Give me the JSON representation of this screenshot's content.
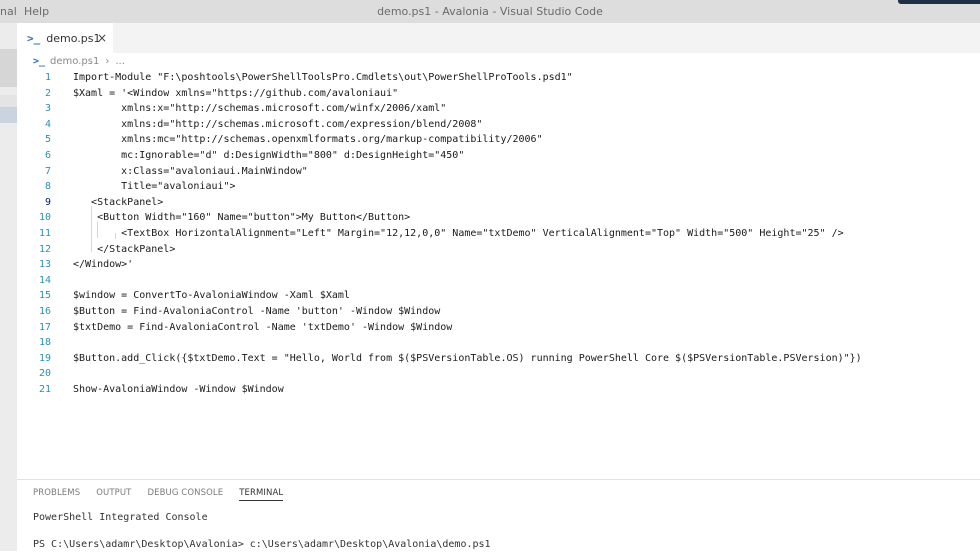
{
  "window": {
    "menu_left": "nal",
    "menu_help": "Help",
    "title": "demo.ps1 - Avalonia - Visual Studio Code"
  },
  "tab": {
    "label": "demo.ps1",
    "icon": "powershell-icon",
    "close": "×"
  },
  "breadcrumb": {
    "file": "demo.ps1",
    "sep": "›",
    "more": "..."
  },
  "editor": {
    "lines": [
      {
        "n": "1",
        "text": "Import-Module \"F:\\poshtools\\PowerShellToolsPro.Cmdlets\\out\\PowerShellProTools.psd1\""
      },
      {
        "n": "2",
        "text": "$Xaml = '<Window xmlns=\"https://github.com/avaloniaui\""
      },
      {
        "n": "3",
        "text": "        xmlns:x=\"http://schemas.microsoft.com/winfx/2006/xaml\""
      },
      {
        "n": "4",
        "text": "        xmlns:d=\"http://schemas.microsoft.com/expression/blend/2008\""
      },
      {
        "n": "5",
        "text": "        xmlns:mc=\"http://schemas.openxmlformats.org/markup-compatibility/2006\""
      },
      {
        "n": "6",
        "text": "        mc:Ignorable=\"d\" d:DesignWidth=\"800\" d:DesignHeight=\"450\""
      },
      {
        "n": "7",
        "text": "        x:Class=\"avaloniaui.MainWindow\""
      },
      {
        "n": "8",
        "text": "        Title=\"avaloniaui\">"
      },
      {
        "n": "9",
        "text": "   <StackPanel>"
      },
      {
        "n": "10",
        "text": "    <Button Width=\"160\" Name=\"button\">My Button</Button>"
      },
      {
        "n": "11",
        "text": "        <TextBox HorizontalAlignment=\"Left\" Margin=\"12,12,0,0\" Name=\"txtDemo\" VerticalAlignment=\"Top\" Width=\"500\" Height=\"25\" />"
      },
      {
        "n": "12",
        "text": "    </StackPanel>"
      },
      {
        "n": "13",
        "text": "</Window>'"
      },
      {
        "n": "14",
        "text": ""
      },
      {
        "n": "15",
        "text": "$window = ConvertTo-AvaloniaWindow -Xaml $Xaml"
      },
      {
        "n": "16",
        "text": "$Button = Find-AvaloniaControl -Name 'button' -Window $Window"
      },
      {
        "n": "17",
        "text": "$txtDemo = Find-AvaloniaControl -Name 'txtDemo' -Window $Window"
      },
      {
        "n": "18",
        "text": ""
      },
      {
        "n": "19",
        "text": "$Button.add_Click({$txtDemo.Text = \"Hello, World from $($PSVersionTable.OS) running PowerShell Core $($PSVersionTable.PSVersion)\"})"
      },
      {
        "n": "20",
        "text": ""
      },
      {
        "n": "21",
        "text": "Show-AvaloniaWindow -Window $Window"
      }
    ]
  },
  "panel": {
    "tabs": [
      "PROBLEMS",
      "OUTPUT",
      "DEBUG CONSOLE",
      "TERMINAL"
    ],
    "active_tab": "TERMINAL",
    "terminal_header": "PowerShell Integrated Console",
    "terminal_prompt": "PS C:\\Users\\adamr\\Desktop\\Avalonia> c:\\Users\\adamr\\Desktop\\Avalonia\\demo.ps1"
  },
  "colors": {
    "line_number": "#2b91af",
    "string": "#a31515",
    "accent": "#2f6fb5"
  }
}
